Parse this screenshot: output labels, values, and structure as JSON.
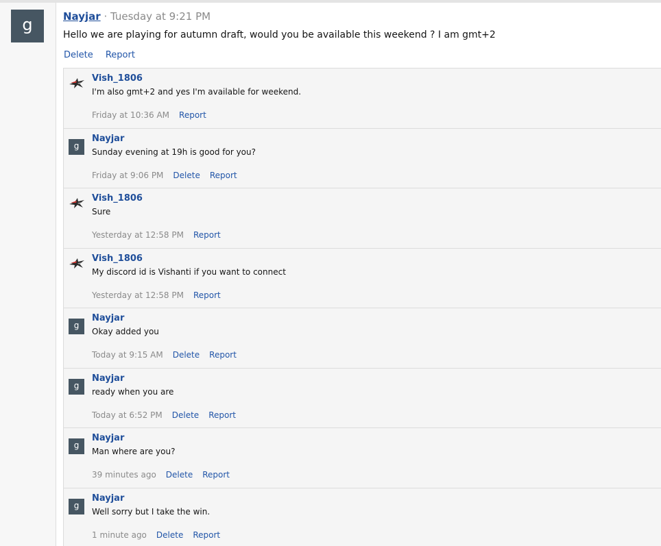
{
  "post": {
    "avatar_letter": "g",
    "author": "Nayjar",
    "separator": "·",
    "time": "Tuesday at 9:21 PM",
    "body": "Hello we are playing for autumn draft, would you be available this weekend ? I am gmt+2",
    "actions": {
      "delete": "Delete",
      "report": "Report"
    }
  },
  "comments": [
    {
      "avatar": "logo",
      "author": "Vish_1806",
      "text": "I'm also gmt+2 and yes I'm available for weekend.",
      "time": "Friday at 10:36 AM",
      "actions": [
        "Report"
      ]
    },
    {
      "avatar": "g",
      "author": "Nayjar",
      "text": "Sunday evening at 19h is good for you?",
      "time": "Friday at 9:06 PM",
      "actions": [
        "Delete",
        "Report"
      ]
    },
    {
      "avatar": "logo",
      "author": "Vish_1806",
      "text": "Sure",
      "time": "Yesterday at 12:58 PM",
      "actions": [
        "Report"
      ]
    },
    {
      "avatar": "logo",
      "author": "Vish_1806",
      "text": "My discord id is Vishanti if you want to connect",
      "time": "Yesterday at 12:58 PM",
      "actions": [
        "Report"
      ]
    },
    {
      "avatar": "g",
      "author": "Nayjar",
      "text": "Okay added you",
      "time": "Today at 9:15 AM",
      "actions": [
        "Delete",
        "Report"
      ]
    },
    {
      "avatar": "g",
      "author": "Nayjar",
      "text": "ready when you are",
      "time": "Today at 6:52 PM",
      "actions": [
        "Delete",
        "Report"
      ]
    },
    {
      "avatar": "g",
      "author": "Nayjar",
      "text": "Man where are you?",
      "time": "39 minutes ago",
      "actions": [
        "Delete",
        "Report"
      ]
    },
    {
      "avatar": "g",
      "author": "Nayjar",
      "text": "Well sorry but I take the win.",
      "time": "1 minute ago",
      "actions": [
        "Delete",
        "Report"
      ]
    }
  ],
  "colors": {
    "link": "#2155a8",
    "author": "#1f4e9a",
    "avatar_bg": "#465662",
    "meta_text": "#8a8a8a",
    "thread_bg": "#f5f5f5"
  }
}
